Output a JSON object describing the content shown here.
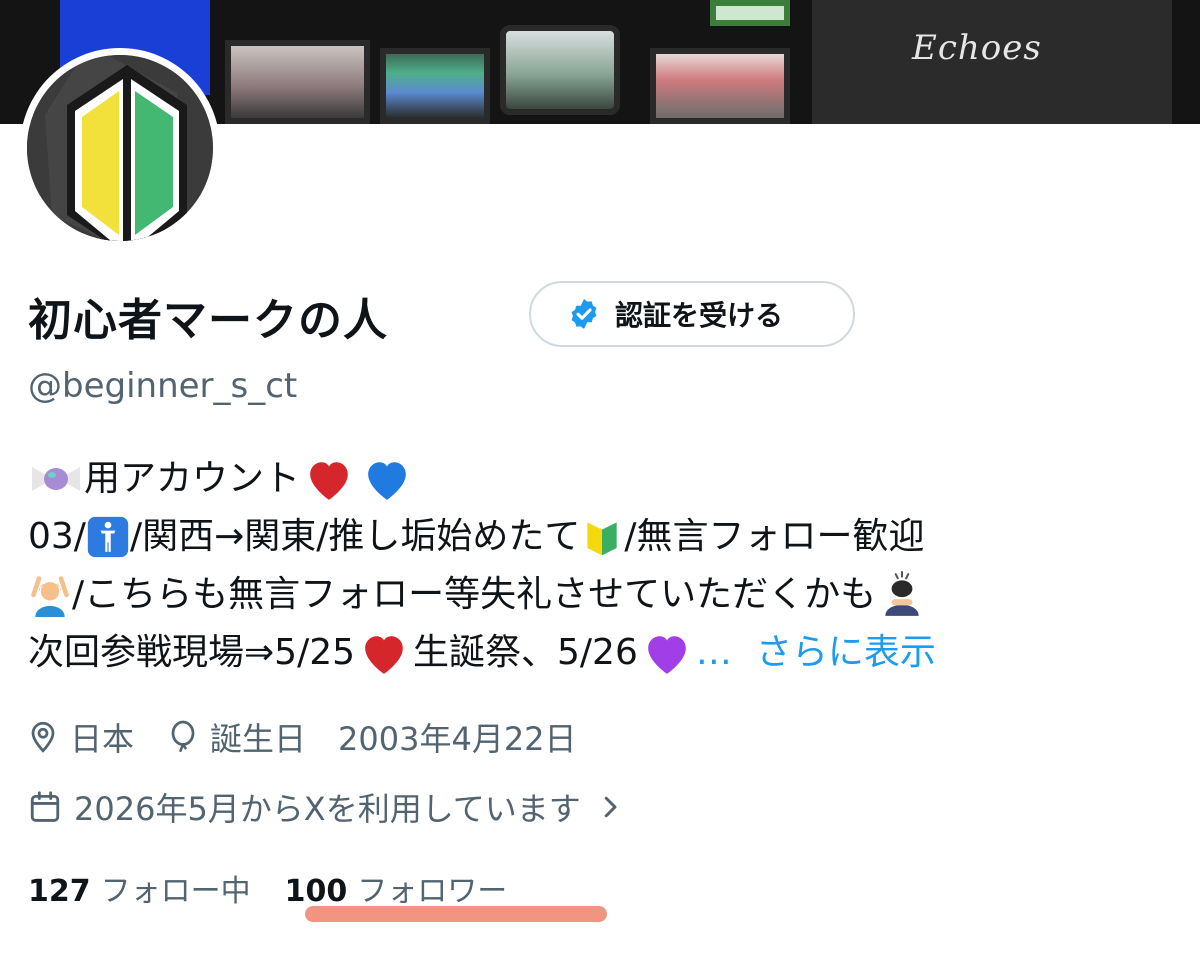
{
  "profile": {
    "display_name": "初心者マークの人",
    "verify_button_label": "認証を受ける",
    "handle": "@beginner_s_ct",
    "banner_text": "Echoes",
    "bio": {
      "line1_text": "用アカウント",
      "line2_a": "03/",
      "line2_b": "/関西→関東/推し垢始めたて",
      "line2_c": "/無言フォロー歓迎",
      "line3_a": "/こちらも無言フォロー等失礼させていただくかも",
      "line4_a": "次回参戦現場⇒5/25",
      "line4_b": "生誕祭、5/26",
      "line4_ellipsis": "…",
      "more_link": "さらに表示"
    },
    "location": "日本",
    "birthday": "誕生日　2003年4月22日",
    "joined": "2026年5月からXを利用しています",
    "following_count": "127",
    "following_label": "フォロー中",
    "followers_count": "100",
    "followers_label": "フォロワー"
  },
  "colors": {
    "link": "#1d9bf0",
    "secondary_text": "#536471",
    "highlight_underline": "#f08a74"
  }
}
